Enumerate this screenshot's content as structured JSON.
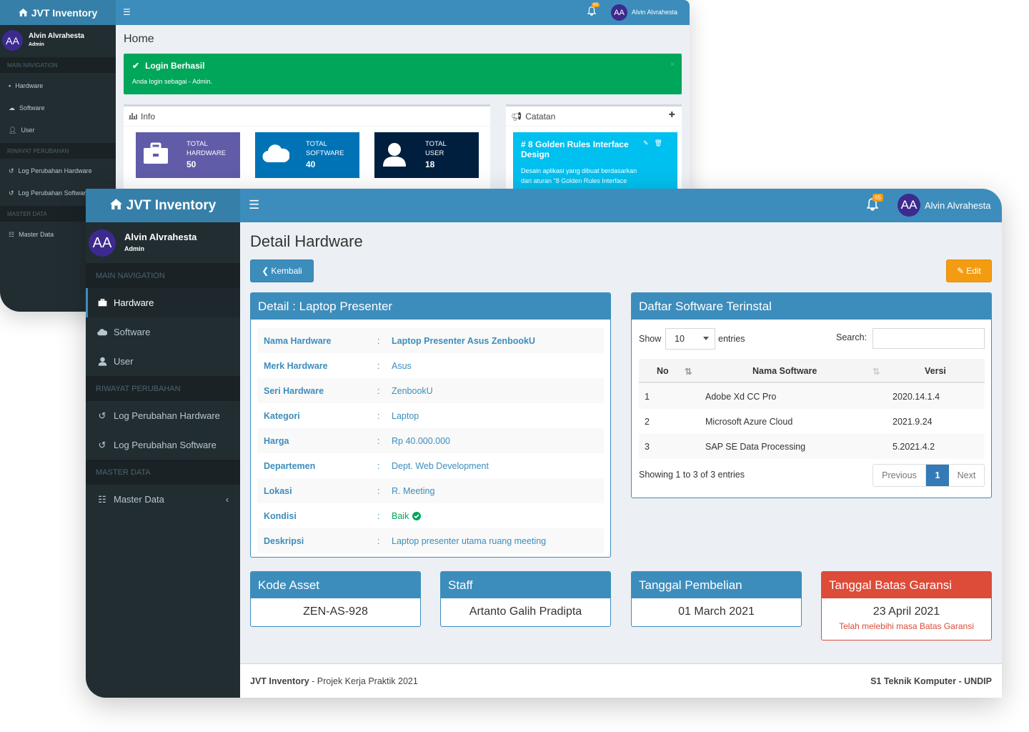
{
  "colors": {
    "primary": "#3c8dbc",
    "success": "#00a65a",
    "warning": "#f39c12",
    "danger": "#dd4b39",
    "sidebar": "#222d32",
    "avatar": "#3d2a8f",
    "info": "#00c0ef"
  },
  "app": {
    "name": "JVT Inventory"
  },
  "user": {
    "initials": "AA",
    "name": "Alvin Alvrahesta",
    "role": "Admin"
  },
  "notifications": {
    "count": "65"
  },
  "back": {
    "sidebar": {
      "main_head": "MAIN NAVIGATION",
      "items_main": [
        {
          "label": "Hardware",
          "icon": "briefcase-icon"
        },
        {
          "label": "Software",
          "icon": "cloud-icon"
        },
        {
          "label": "User",
          "icon": "user-icon"
        }
      ],
      "riwayat_head": "RIWAYAT PERUBAHAN",
      "items_riwayat": [
        {
          "label": "Log Perubahan Hardware",
          "icon": "history-icon"
        },
        {
          "label": "Log Perubahan Software",
          "icon": "history-icon"
        }
      ],
      "master_head": "MASTER DATA",
      "items_master": [
        {
          "label": "Master Data",
          "icon": "list-icon"
        }
      ]
    },
    "page_title": "Home",
    "alert": {
      "title": "Login Berhasil",
      "body": "Anda login sebagai - Admin.",
      "close": "×"
    },
    "info_box": {
      "title": "Info"
    },
    "tiles": [
      {
        "label1": "TOTAL",
        "label2": "HARDWARE",
        "value": "50",
        "color": "#605ca8",
        "icon": "briefcase-icon"
      },
      {
        "label1": "TOTAL",
        "label2": "SOFTWARE",
        "value": "40",
        "color": "#0073b7",
        "icon": "cloud-icon"
      },
      {
        "label1": "TOTAL",
        "label2": "USER",
        "value": "18",
        "color": "#001f3f",
        "icon": "user-icon"
      }
    ],
    "catatan": {
      "title": "Catatan",
      "add": "+",
      "note_title": "# 8 Golden Rules Interface Design",
      "note_line1": "Desain aplikasi yang dibuat berdasarkan",
      "note_line2": "dari aturan \"8 Golden Rules Interface"
    }
  },
  "front": {
    "sidebar": {
      "main_head": "MAIN NAVIGATION",
      "items_main": [
        {
          "label": "Hardware",
          "icon": "briefcase-icon",
          "active": true
        },
        {
          "label": "Software",
          "icon": "cloud-icon"
        },
        {
          "label": "User",
          "icon": "user-icon"
        }
      ],
      "riwayat_head": "RIWAYAT PERUBAHAN",
      "items_riwayat": [
        {
          "label": "Log Perubahan Hardware",
          "icon": "history-icon"
        },
        {
          "label": "Log Perubahan Software",
          "icon": "history-icon"
        }
      ],
      "master_head": "MASTER DATA",
      "items_master": [
        {
          "label": "Master Data",
          "icon": "list-icon"
        }
      ],
      "chevron": "‹"
    },
    "page_title": "Detail Hardware",
    "btn_back": "Kembali",
    "btn_edit": "Edit",
    "detail": {
      "title": "Detail : Laptop Presenter",
      "rows": [
        {
          "key": "Nama Hardware",
          "value": "Laptop Presenter Asus ZenbookU"
        },
        {
          "key": "Merk Hardware",
          "value": "Asus"
        },
        {
          "key": "Seri Hardware",
          "value": "ZenbookU"
        },
        {
          "key": "Kategori",
          "value": "Laptop"
        },
        {
          "key": "Harga",
          "value": "Rp 40.000.000"
        },
        {
          "key": "Departemen",
          "value": "Dept. Web Development"
        },
        {
          "key": "Lokasi",
          "value": "R. Meeting"
        },
        {
          "key": "Kondisi",
          "value": "Baik"
        },
        {
          "key": "Deskripsi",
          "value": "Laptop presenter utama ruang meeting"
        }
      ],
      "colon": ":"
    },
    "software": {
      "title": "Daftar Software Terinstal",
      "show_label": "Show",
      "page_size": "10",
      "entries_label": "entries",
      "search_label": "Search:",
      "search_value": "",
      "columns": {
        "no": "No",
        "name": "Nama Software",
        "version": "Versi"
      },
      "rows": [
        {
          "no": "1",
          "name": "Adobe Xd CC Pro",
          "version": "2020.14.1.4"
        },
        {
          "no": "2",
          "name": "Microsoft Azure Cloud",
          "version": "2021.9.24"
        },
        {
          "no": "3",
          "name": "SAP SE Data Processing",
          "version": "5.2021.4.2"
        }
      ],
      "info": "Showing 1 to 3 of 3 entries",
      "pager": {
        "prev": "Previous",
        "current": "1",
        "next": "Next"
      }
    },
    "summary": [
      {
        "title": "Kode Asset",
        "value": "ZEN-AS-928"
      },
      {
        "title": "Staff",
        "value": "Artanto Galih Pradipta"
      },
      {
        "title": "Tanggal Pembelian",
        "value": "01 March 2021"
      },
      {
        "title": "Tanggal Batas Garansi",
        "value": "23 April 2021",
        "note": "Telah melebihi masa Batas Garansi"
      }
    ],
    "footer": {
      "brand": "JVT Inventory",
      "left": " - Projek Kerja Praktik 2021",
      "right": "S1 Teknik Komputer - UNDIP"
    }
  }
}
